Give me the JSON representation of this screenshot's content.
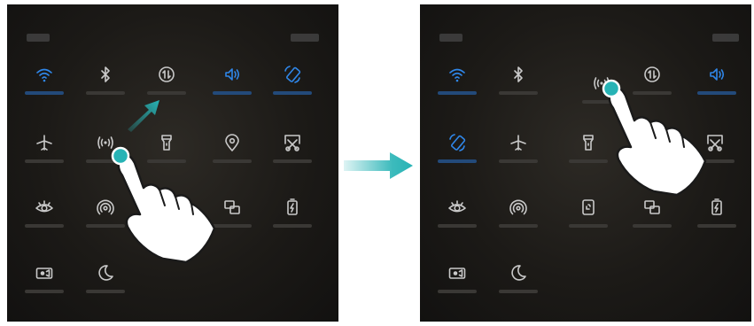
{
  "colors": {
    "active": "#2f86e8",
    "inactive": "#c9c9c9",
    "accent": "#27b3b5",
    "background": "#1b1916"
  },
  "left_panel": {
    "tiles": [
      {
        "id": "wifi",
        "icon": "wifi-icon",
        "active": true
      },
      {
        "id": "bluetooth",
        "icon": "bluetooth-icon",
        "active": false
      },
      {
        "id": "mobile-data",
        "icon": "mobile-data-icon",
        "active": false
      },
      {
        "id": "sound",
        "icon": "sound-icon",
        "active": true
      },
      {
        "id": "auto-rotate",
        "icon": "rotate-icon",
        "active": true
      },
      {
        "id": "airplane",
        "icon": "airplane-icon",
        "active": false
      },
      {
        "id": "hotspot",
        "icon": "hotspot-icon",
        "active": false
      },
      {
        "id": "flashlight",
        "icon": "flashlight-icon",
        "active": false
      },
      {
        "id": "location",
        "icon": "location-icon",
        "active": false
      },
      {
        "id": "screenshot",
        "icon": "screenshot-icon",
        "active": false
      },
      {
        "id": "eye-comfort",
        "icon": "eye-icon",
        "active": false
      },
      {
        "id": "nfc",
        "icon": "nfc-icon",
        "active": false
      },
      {
        "id": "multi-screen",
        "icon": "multi-screen-icon",
        "active": false
      },
      {
        "id": "battery-saver",
        "icon": "battery-saver-icon",
        "active": false
      },
      {
        "id": "screen-recorder",
        "icon": "screen-recorder-icon",
        "active": false
      },
      {
        "id": "do-not-disturb",
        "icon": "moon-icon",
        "active": false
      }
    ]
  },
  "right_panel": {
    "tiles": [
      {
        "id": "wifi",
        "icon": "wifi-icon",
        "active": true
      },
      {
        "id": "bluetooth",
        "icon": "bluetooth-icon",
        "active": false
      },
      {
        "id": "hotspot",
        "icon": "hotspot-icon",
        "active": false
      },
      {
        "id": "mobile-data",
        "icon": "mobile-data-icon",
        "active": false
      },
      {
        "id": "sound",
        "icon": "sound-icon",
        "active": true
      },
      {
        "id": "auto-rotate",
        "icon": "rotate-icon",
        "active": true
      },
      {
        "id": "airplane",
        "icon": "airplane-icon",
        "active": false
      },
      {
        "id": "flashlight",
        "icon": "flashlight-icon",
        "active": false
      },
      {
        "id": "location",
        "icon": "location-icon",
        "active": false
      },
      {
        "id": "screenshot",
        "icon": "screenshot-icon",
        "active": false
      },
      {
        "id": "eye-comfort",
        "icon": "eye-icon",
        "active": false
      },
      {
        "id": "nfc",
        "icon": "nfc-icon",
        "active": false
      },
      {
        "id": "phone-clone",
        "icon": "phone-icon",
        "active": false
      },
      {
        "id": "multi-screen",
        "icon": "multi-screen-icon",
        "active": false
      },
      {
        "id": "battery-saver",
        "icon": "battery-saver-icon",
        "active": false
      },
      {
        "id": "screen-recorder",
        "icon": "screen-recorder-icon",
        "active": false
      },
      {
        "id": "do-not-disturb",
        "icon": "moon-icon",
        "active": false
      }
    ]
  }
}
